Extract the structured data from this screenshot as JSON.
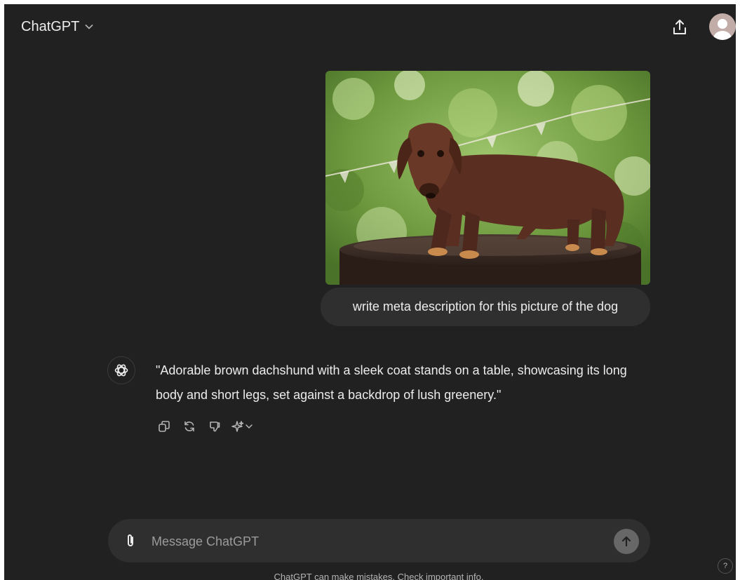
{
  "header": {
    "model_name": "ChatGPT",
    "icons": {
      "model_chevron": "chevron-down-icon",
      "share": "share-icon",
      "avatar": "user-avatar"
    }
  },
  "conversation": {
    "user_message": {
      "image_subject": "brown dachshund standing on a table",
      "text": "write meta description for this picture of the dog"
    },
    "assistant_message": {
      "text": "\"Adorable brown dachshund with a sleek coat stands on a table, showcasing its long body and short legs, set against a backdrop of lush greenery.\"",
      "actions": [
        "copy-icon",
        "regenerate-icon",
        "thumbs-down-icon",
        "sparkle-icon"
      ]
    }
  },
  "composer": {
    "placeholder": "Message ChatGPT",
    "value": "",
    "icons": {
      "attach": "paperclip-icon",
      "send": "arrow-up-icon"
    }
  },
  "footer": {
    "disclaimer": "ChatGPT can make mistakes. Check important info.",
    "help_label": "?"
  },
  "colors": {
    "background": "#212121",
    "bubble": "#2f2f2f",
    "text": "#ececec",
    "muted_text": "#9b9b9b",
    "send_button": "#676767"
  }
}
